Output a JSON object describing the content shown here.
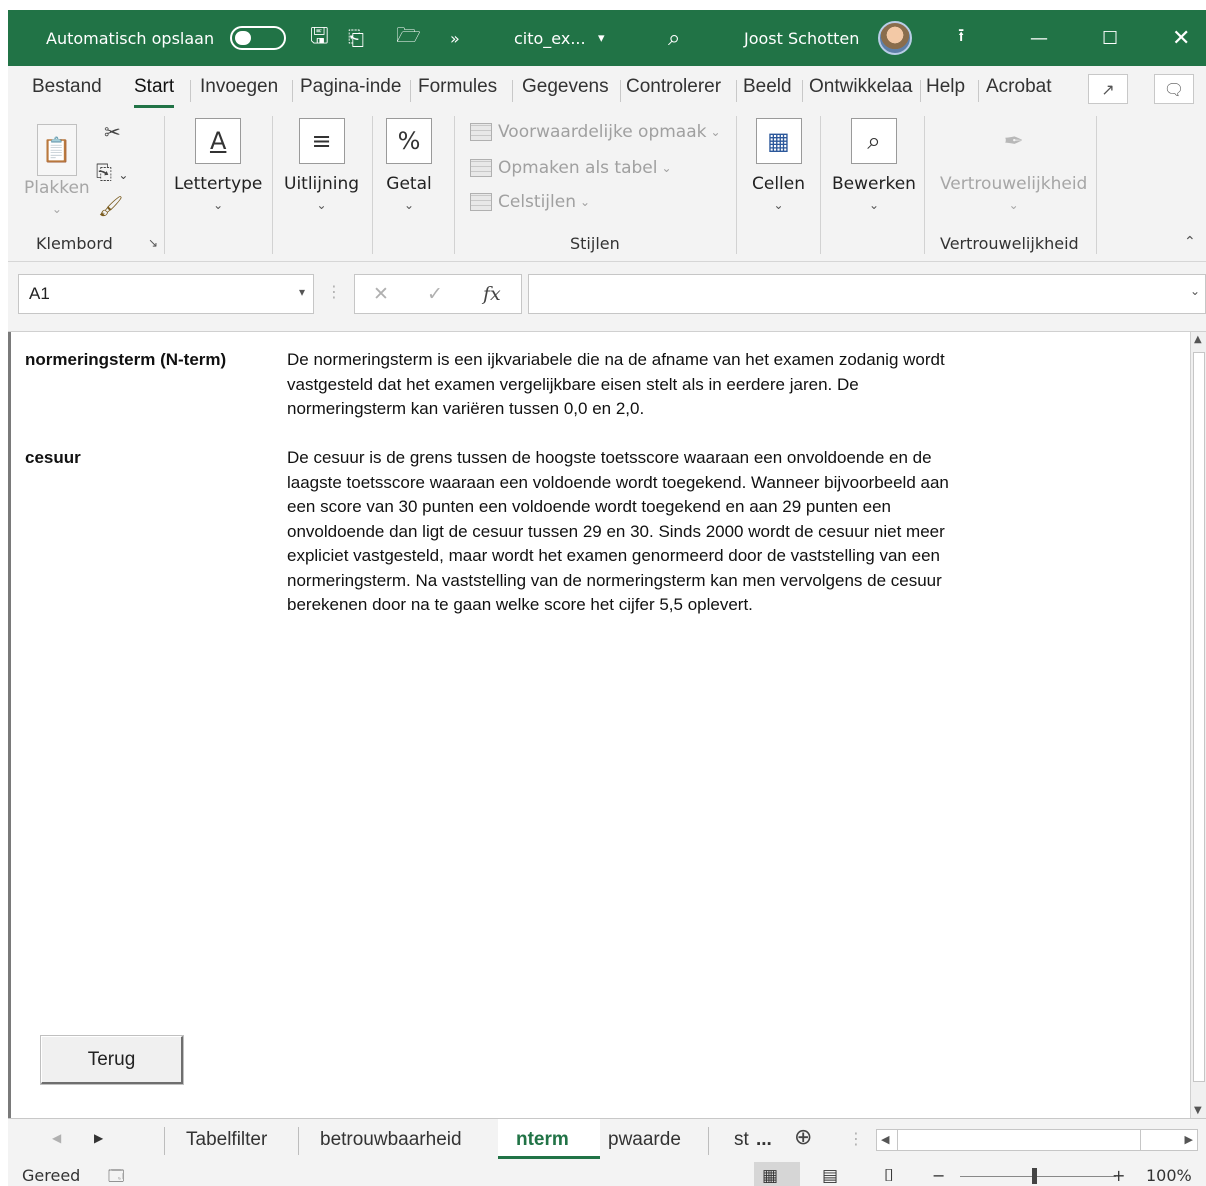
{
  "titlebar": {
    "autosave_label": "Automatisch opslaan",
    "overflow": "»",
    "filename": "cito_ex...",
    "filename_caret": "▾",
    "user_name": "Joost Schotten"
  },
  "ribbon_tabs": [
    "Bestand",
    "Start",
    "Invoegen",
    "Pagina-inde",
    "Formules",
    "Gegevens",
    "Controlerer",
    "Beeld",
    "Ontwikkelaa",
    "Help",
    "Acrobat"
  ],
  "ribbon": {
    "paste_label": "Plakken",
    "clipboard_group": "Klembord",
    "font_label": "Lettertype",
    "alignment_label": "Uitlijning",
    "number_label": "Getal",
    "conditional_format": "Voorwaardelijke opmaak",
    "format_as_table": "Opmaken als tabel",
    "cell_styles": "Celstijlen",
    "styles_group": "Stijlen",
    "cells_label": "Cellen",
    "edit_label": "Bewerken",
    "sensitivity_label": "Vertrouwelijkheid",
    "sensitivity_group": "Vertrouwelijkheid"
  },
  "formula_bar": {
    "name_box": "A1",
    "fx": "fx",
    "formula": ""
  },
  "sheet": {
    "entries": [
      {
        "term": "normeringsterm (N-term)",
        "lines": [
          "De normeringsterm is een ijkvariabele die na de afname van het examen zodanig wordt",
          "vastgesteld dat het examen vergelijkbare eisen stelt als in eerdere jaren. De",
          "normeringsterm kan variëren tussen 0,0 en 2,0."
        ]
      },
      {
        "term": "cesuur",
        "lines": [
          "De cesuur is de grens tussen de hoogste toetsscore waaraan een onvoldoende en de",
          "laagste toetsscore waaraan een voldoende wordt toegekend. Wanneer bijvoorbeeld aan",
          "een score van 30 punten een voldoende wordt toegekend en aan 29 punten een",
          "onvoldoende dan ligt de cesuur tussen 29 en 30. Sinds 2000 wordt de cesuur niet meer",
          "expliciet vastgesteld, maar wordt het examen genormeerd door de vaststelling van een",
          "normeringsterm. Na vaststelling van de normeringsterm kan men vervolgens de cesuur",
          "berekenen door na te gaan welke score het cijfer 5,5 oplevert."
        ]
      }
    ],
    "back_button": "Terug"
  },
  "sheet_tabs": [
    "Tabelfilter",
    "betrouwbaarheid",
    "nterm",
    "pwaarde",
    "st"
  ],
  "sheet_tabs_more": "...",
  "statusbar": {
    "status": "Gereed",
    "zoom": "100%"
  }
}
